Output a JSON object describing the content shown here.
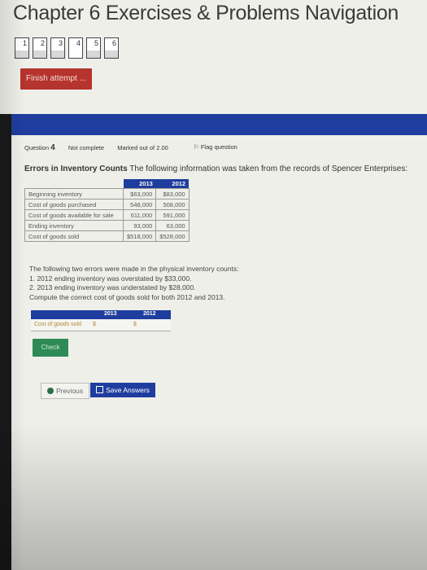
{
  "page": {
    "title": "Chapter 6 Exercises & Problems Navigation"
  },
  "nav": {
    "questions": [
      {
        "label": "1",
        "state": "done"
      },
      {
        "label": "2",
        "state": "done"
      },
      {
        "label": "3",
        "state": "done"
      },
      {
        "label": "4",
        "state": "current"
      },
      {
        "label": "5",
        "state": "done"
      },
      {
        "label": "6",
        "state": "done"
      }
    ],
    "finish_label": "Finish attempt ..."
  },
  "question": {
    "prefix": "Question",
    "number": "4",
    "status": "Not complete",
    "marks": "Marked out of 2.00",
    "flag_label": "Flag question",
    "heading_bold": "Errors in Inventory Counts",
    "heading_rest": " The following information was taken from the records of Spencer Enterprises:",
    "table": {
      "headers": [
        "",
        "2013",
        "2012"
      ],
      "rows": [
        [
          "Beginning inventory",
          "$63,000",
          "$83,000"
        ],
        [
          "Cost of goods purchased",
          "548,000",
          "508,000"
        ],
        [
          "Cost of goods available for sale",
          "611,000",
          "591,000"
        ],
        [
          "Ending inventory",
          "93,000",
          "63,000"
        ],
        [
          "Cost of goods sold",
          "$518,000",
          "$528,000"
        ]
      ]
    },
    "errors_intro": "The following two errors were made in the physical inventory counts:",
    "errors": [
      "1. 2012 ending inventory was overstated by $33,000.",
      "2. 2013 ending inventory was understated by $28,000."
    ],
    "instruction": "Compute the correct cost of goods sold for both 2012 and 2013.",
    "answer": {
      "col_2013": "2013",
      "col_2012": "2012",
      "row_label": "Cost of goods sold",
      "currency_2013": "$",
      "currency_2012": "$",
      "value_2013": "",
      "value_2012": ""
    },
    "check_label": "Check"
  },
  "footer": {
    "previous_label": "Previous",
    "save_label": "Save Answers"
  },
  "colors": {
    "accent_blue": "#1f3d9e",
    "finish_red": "#b5342d",
    "check_green": "#2e8b57"
  }
}
